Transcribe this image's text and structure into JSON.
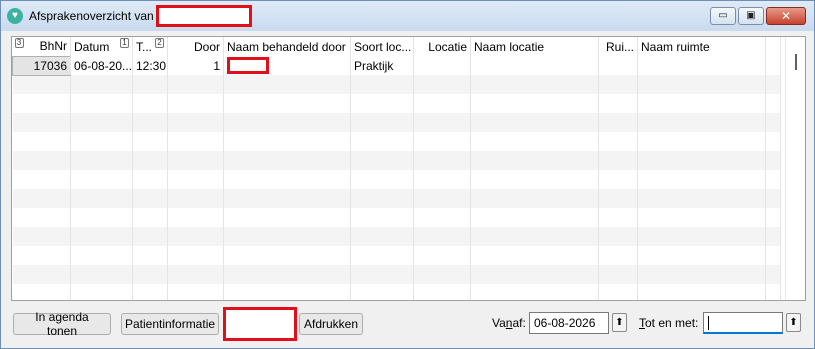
{
  "window": {
    "title": "Afsprakenoverzicht van",
    "minimize": "▭",
    "maximize": "▣",
    "close": "✕"
  },
  "table": {
    "headers": {
      "bhnr": "BhNr",
      "datum": "Datum",
      "tijd": "T...",
      "door": "Door",
      "naam_behandeld": "Naam behandeld door",
      "soort": "Soort loc...",
      "locatie": "Locatie",
      "naam_locatie": "Naam locatie",
      "ruimte": "Rui...",
      "naam_ruimte": "Naam ruimte"
    },
    "sort_indicators": {
      "bhnr": "3",
      "datum": "1",
      "tijd": "2"
    },
    "rows": [
      {
        "bhnr": "17036",
        "datum": "06-08-20...",
        "tijd": "12:30",
        "door": "1",
        "soort": "Praktijk",
        "locatie": "",
        "naam_locatie": "",
        "ruimte": "",
        "naam_ruimte": ""
      }
    ]
  },
  "buttons": {
    "agenda": "In agenda tonen",
    "patient": "Patientinformatie",
    "print": "Afdrukken"
  },
  "filters": {
    "vanaf_label_a": "Va",
    "vanaf_label_b": "n",
    "vanaf_label_c": "af:",
    "vanaf_value": "06-08-2026",
    "totenmet_label_a": "T",
    "totenmet_label_b": "ot en met:",
    "totenmet_value": ""
  }
}
